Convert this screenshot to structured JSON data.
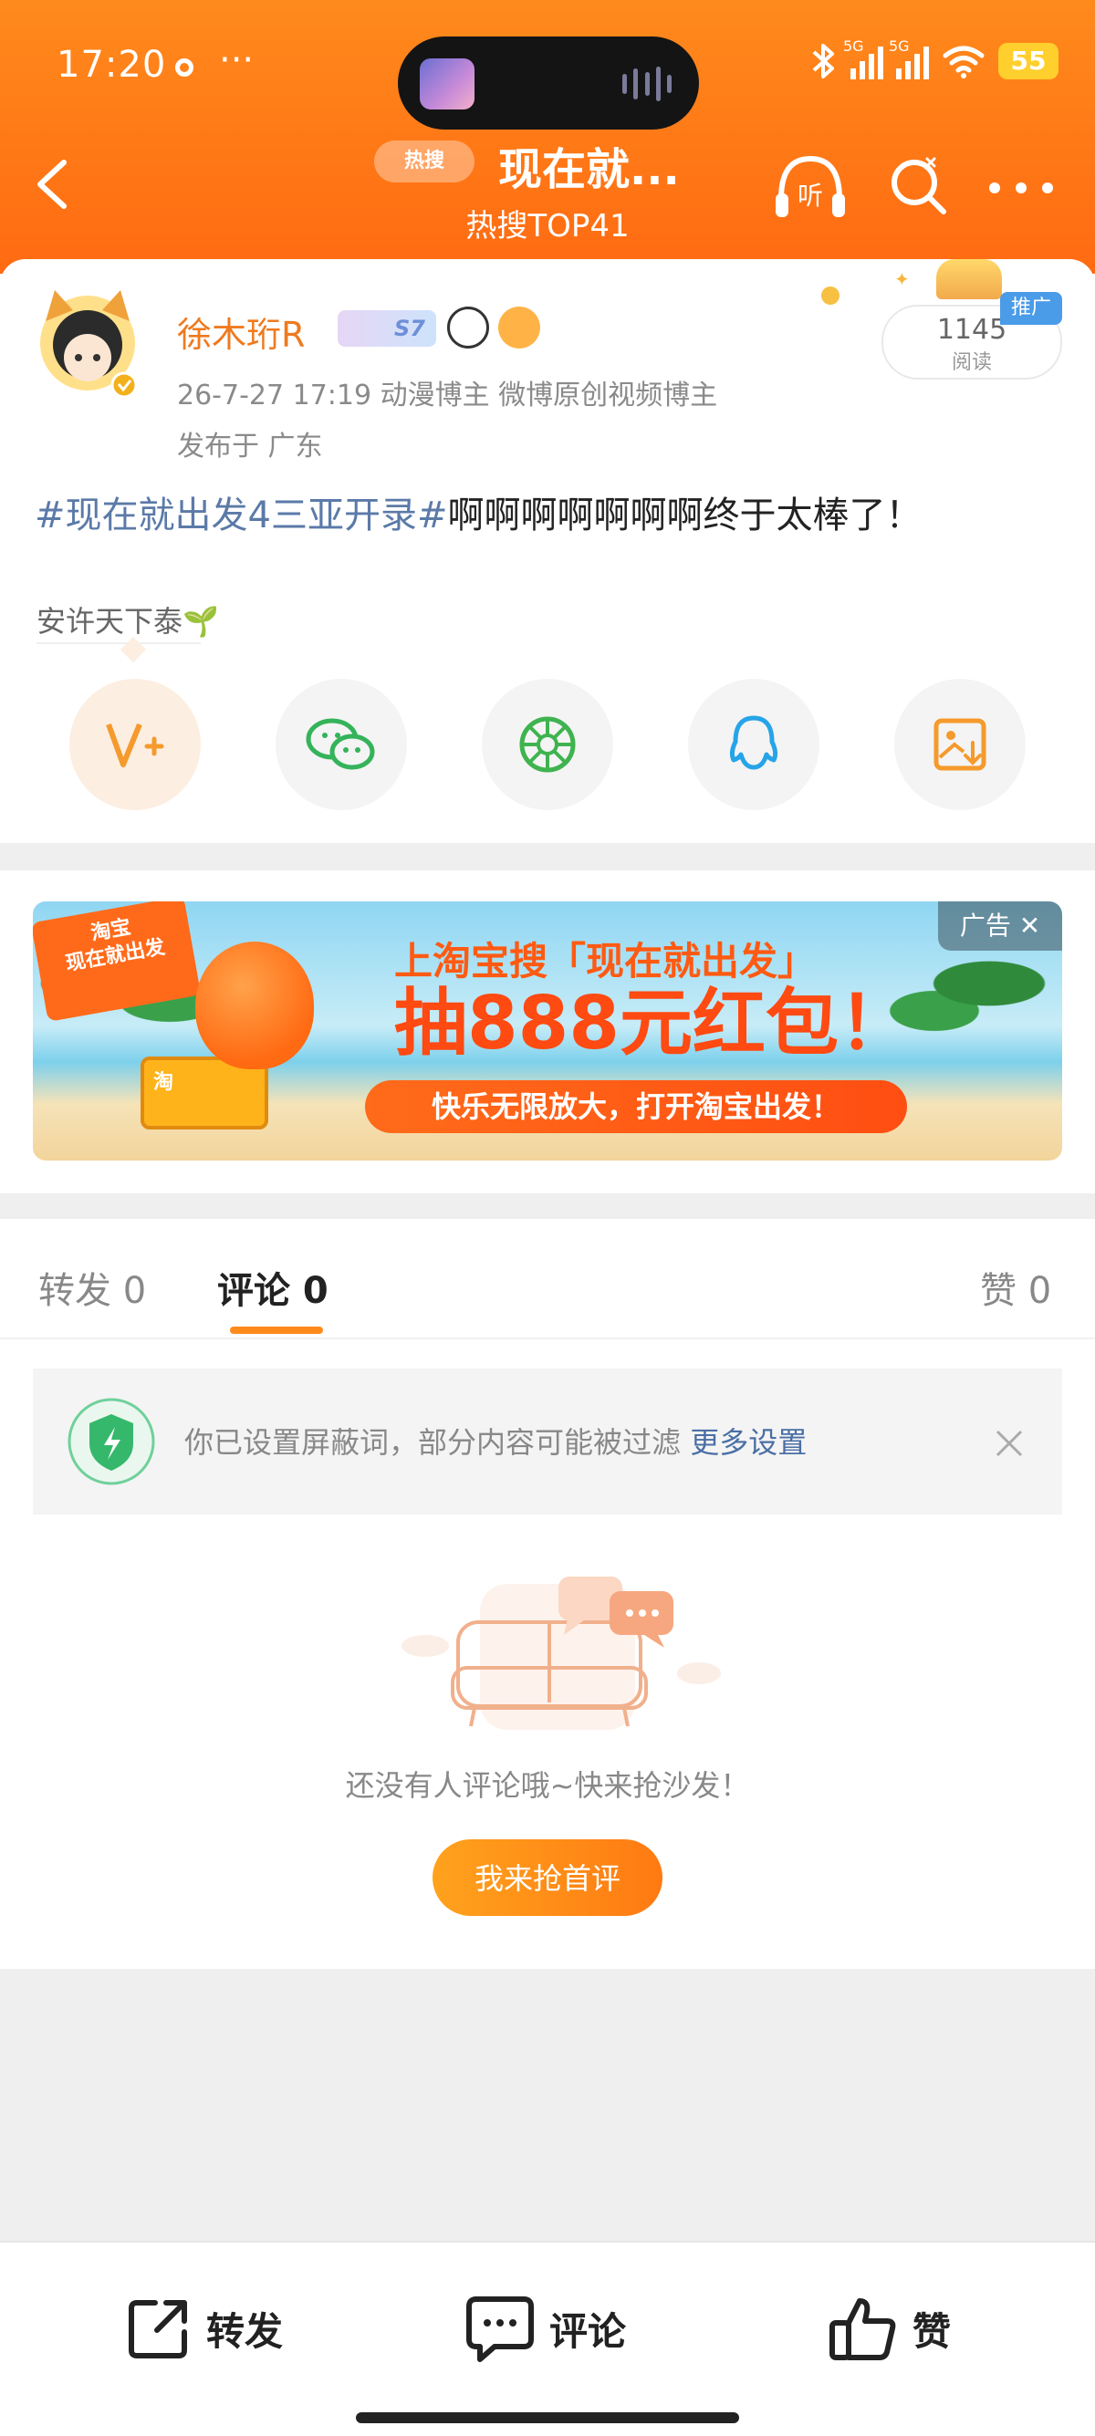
{
  "status_bar": {
    "time": "17:20",
    "more": "···",
    "signal_1": "5G",
    "signal_2": "5G",
    "battery": "55"
  },
  "nav": {
    "hot_badge": "热搜",
    "title": "现在就...",
    "subtitle": "热搜TOP41",
    "listen_label": "听"
  },
  "post": {
    "user_name": "徐木珩R",
    "level_badge": "S7",
    "meta": "26-7-27 17:19  动漫博主 微博原创视频博主",
    "location": "发布于 广东",
    "read_count": "1145",
    "read_label": "阅读",
    "promo_tag": "推广",
    "topic": "#现在就出发4三亚开录#",
    "text": "啊啊啊啊啊啊啊终于太棒了！",
    "source_tag": "安许天下泰🌱"
  },
  "share": {
    "items": [
      {
        "name": "vplus",
        "icon": "vplus-icon",
        "color": "#f59a2c"
      },
      {
        "name": "wechat",
        "icon": "wechat-icon",
        "color": "#35b35a"
      },
      {
        "name": "moments",
        "icon": "moments-icon",
        "color": "#3fb34f"
      },
      {
        "name": "qq",
        "icon": "qq-icon",
        "color": "#27a4e8"
      },
      {
        "name": "save-image",
        "icon": "save-image-icon",
        "color": "#f59a2c"
      }
    ]
  },
  "ad": {
    "logo_text": "淘宝\n现在就出发",
    "headline1": "上淘宝搜「现在就出发」",
    "headline2": "抽888元红包！",
    "pill": "快乐无限放大，打开淘宝出发！",
    "close_tag": "广告 ✕",
    "cart_label": "淘"
  },
  "tabs": {
    "repost": "转发 0",
    "comment": "评论 0",
    "like": "赞 0"
  },
  "notice": {
    "text": "你已设置屏蔽词，部分内容可能被过滤",
    "link": "更多设置"
  },
  "empty": {
    "text": "还没有人评论哦~快来抢沙发！",
    "button": "我来抢首评"
  },
  "bottom_bar": {
    "repost": "转发",
    "comment": "评论",
    "like": "赞"
  },
  "colors": {
    "brand_orange": "#ff7a12",
    "link_blue": "#4a6fa5",
    "accent_orange": "#ff8a1c"
  }
}
